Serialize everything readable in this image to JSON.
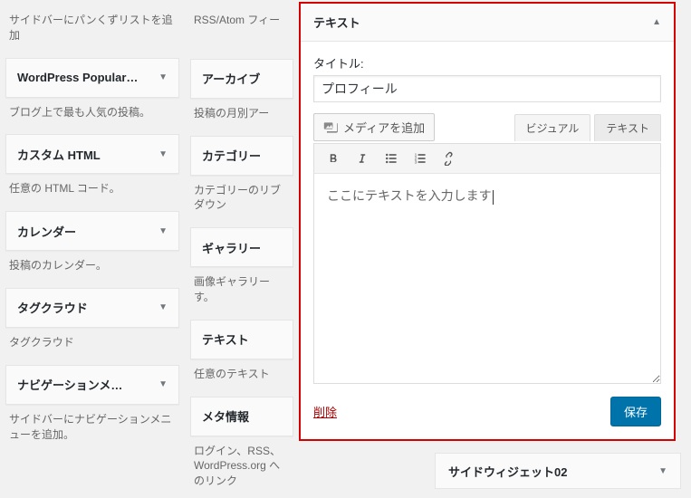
{
  "col1": [
    {
      "title": "",
      "desc": "サイドバーにパンくずリストを追加"
    },
    {
      "title": "WordPress Popular…",
      "desc": "ブログ上で最も人気の投稿。"
    },
    {
      "title": "カスタム HTML",
      "desc": "任意の HTML コード。"
    },
    {
      "title": "カレンダー",
      "desc": "投稿のカレンダー。"
    },
    {
      "title": "タグクラウド",
      "desc": "タグクラウド"
    },
    {
      "title": "ナビゲーションメ…",
      "desc": "サイドバーにナビゲーションメニューを追加。"
    }
  ],
  "col2": [
    {
      "title": "RSS/Atom フィー",
      "desc": ""
    },
    {
      "title": "アーカイブ",
      "desc": "投稿の月別アー"
    },
    {
      "title": "カテゴリー",
      "desc": "カテゴリーのリブダウン"
    },
    {
      "title": "ギャラリー",
      "desc": "画像ギャラリーす。"
    },
    {
      "title": "テキスト",
      "desc": "任意のテキスト"
    },
    {
      "title": "メタ情報",
      "desc": "ログイン、RSS、WordPress.org へのリンク"
    }
  ],
  "editor": {
    "header": "テキスト",
    "title_label": "タイトル:",
    "title_value": "プロフィール",
    "media_button": "メディアを追加",
    "tab_visual": "ビジュアル",
    "tab_text": "テキスト",
    "content": "ここにテキストを入力します",
    "delete": "削除",
    "save": "保存"
  },
  "sidebar_area": {
    "title": "サイドウィジェット02"
  }
}
